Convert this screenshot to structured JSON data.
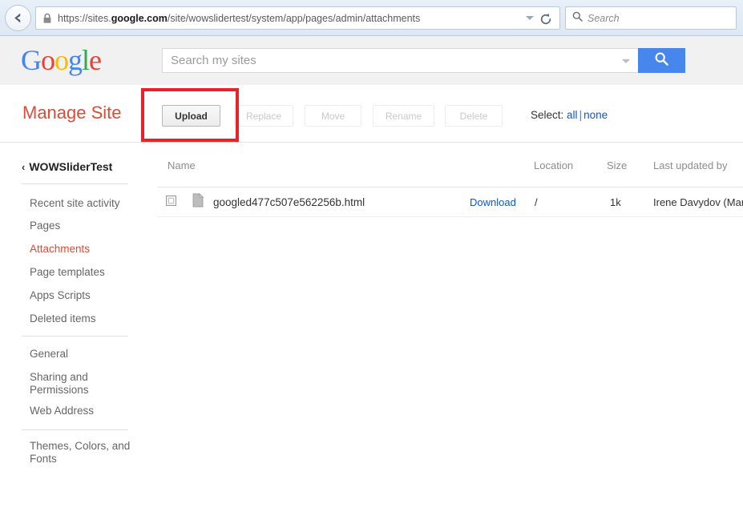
{
  "browser": {
    "back_icon": "back-arrow-icon",
    "lock_icon": "padlock-icon",
    "url_prefix": "https://sites.",
    "url_domain": "google.com",
    "url_suffix": "/site/wowslidertest/system/app/pages/admin/attachments",
    "url_full": "https://sites.google.com/site/wowslidertest/system/app/pages/admin/attachments",
    "dropdown_icon": "chevron-down-icon",
    "reload_icon": "reload-icon",
    "search_icon": "search-icon",
    "search_placeholder": "Search",
    "search_value": ""
  },
  "google_header": {
    "logo_letters": [
      {
        "char": "G",
        "color": "#4285f4"
      },
      {
        "char": "o",
        "color": "#ea4335"
      },
      {
        "char": "o",
        "color": "#fbbc05"
      },
      {
        "char": "g",
        "color": "#4285f4"
      },
      {
        "char": "l",
        "color": "#34a853"
      },
      {
        "char": "e",
        "color": "#ea4335"
      }
    ],
    "site_search_placeholder": "Search my sites",
    "site_search_value": "",
    "site_search_caret_icon": "chevron-down-icon",
    "site_search_button_icon": "search-icon",
    "accent_blue": "#4787ed"
  },
  "manage_bar": {
    "title": "Manage Site",
    "title_color": "#dd4b39",
    "buttons": [
      {
        "label": "Upload",
        "enabled": true,
        "highlighted": true
      },
      {
        "label": "Replace",
        "enabled": false,
        "highlighted": false
      },
      {
        "label": "Move",
        "enabled": false,
        "highlighted": false
      },
      {
        "label": "Rename",
        "enabled": false,
        "highlighted": false
      },
      {
        "label": "Delete",
        "enabled": false,
        "highlighted": false
      }
    ],
    "select_label": "Select:",
    "select_all": "all",
    "select_divider": "|",
    "select_none": "none",
    "link_color": "#1155cc",
    "highlight_color": "#e8212a"
  },
  "sidebar": {
    "back_chevron_icon": "chevron-left-icon",
    "site_name": "WOWSliderTest",
    "group_1": [
      {
        "label": "Recent site activity",
        "active": false
      },
      {
        "label": "Pages",
        "active": false
      },
      {
        "label": "Attachments",
        "active": true
      },
      {
        "label": "Page templates",
        "active": false
      },
      {
        "label": "Apps Scripts",
        "active": false
      },
      {
        "label": "Deleted items",
        "active": false
      }
    ],
    "group_2": [
      {
        "label": "General",
        "active": false
      },
      {
        "label": "Sharing and Permissions",
        "active": false
      },
      {
        "label": "Web Address",
        "active": false
      }
    ],
    "group_3": [
      {
        "label": "Themes, Colors, and Fonts",
        "active": false
      }
    ],
    "active_color": "#dd4b39"
  },
  "table": {
    "columns": [
      "Name",
      "Location",
      "Size",
      "Last updated by"
    ],
    "rows": [
      {
        "checked": false,
        "file_icon": "document-icon",
        "name": "googled477c507e562256b.html",
        "download_label": "Download",
        "location": "/",
        "size": "1k",
        "updated_by": "Irene Davydov (Mar"
      }
    ]
  }
}
